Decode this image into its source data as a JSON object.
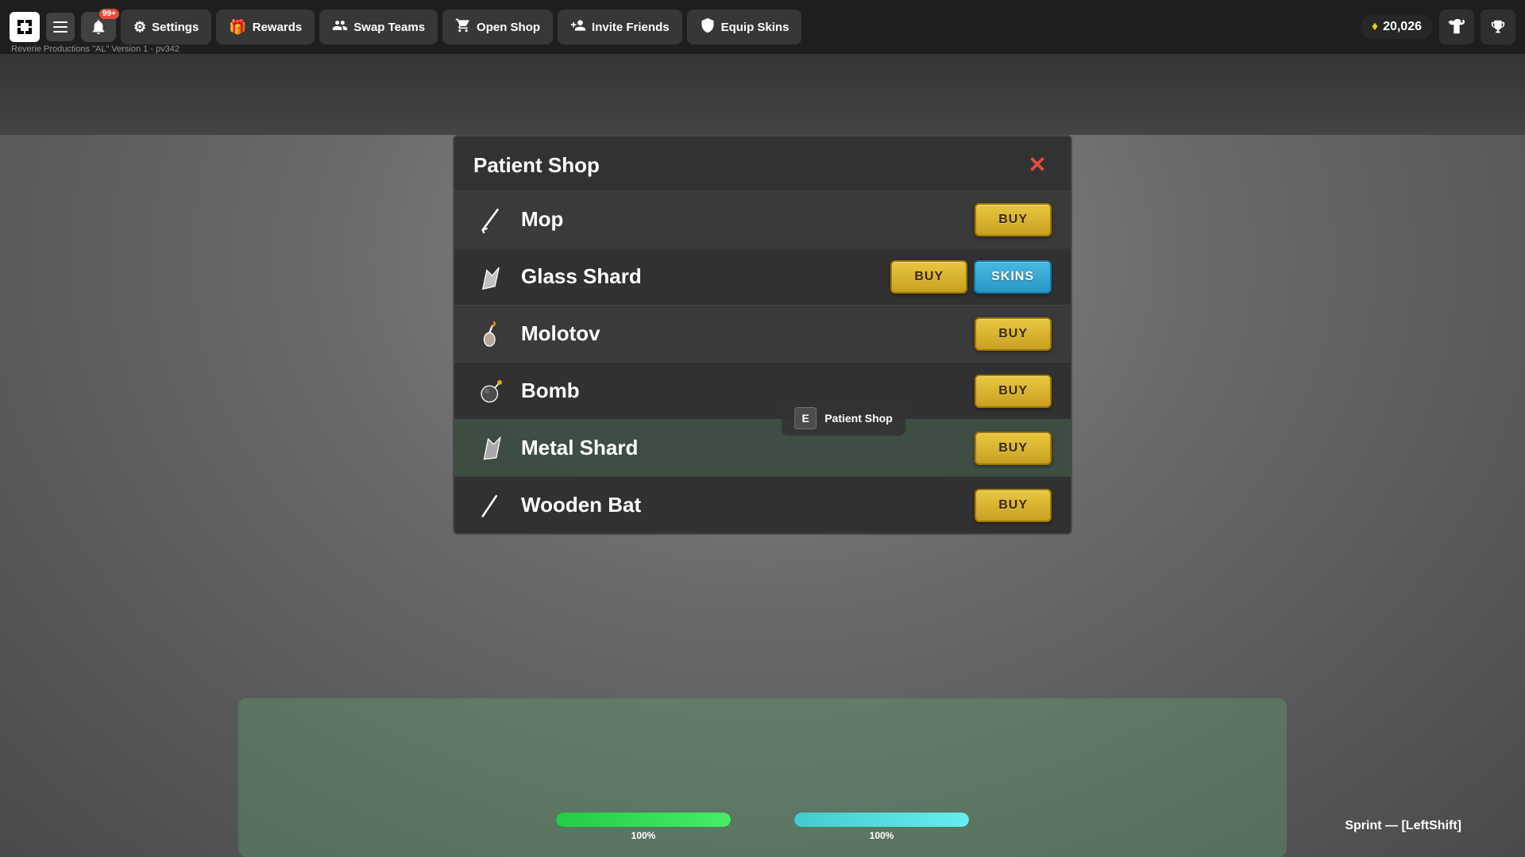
{
  "game": {
    "version": "Reverie Productions \"AL\" Version 1 - pv342"
  },
  "topbar": {
    "notifications_count": "99+",
    "buttons": [
      {
        "id": "settings",
        "label": "Settings",
        "icon": "⚙"
      },
      {
        "id": "rewards",
        "label": "Rewards",
        "icon": "🎁"
      },
      {
        "id": "swap-teams",
        "label": "Swap Teams",
        "icon": "👥"
      },
      {
        "id": "open-shop",
        "label": "Open Shop",
        "icon": "🛒"
      },
      {
        "id": "invite-friends",
        "label": "Invite Friends",
        "icon": "👤"
      },
      {
        "id": "equip-skins",
        "label": "Equip Skins",
        "icon": "🎮"
      }
    ],
    "coins": "20,026",
    "coin_symbol": "♦"
  },
  "shop": {
    "title": "Patient Shop",
    "close_label": "✕",
    "items": [
      {
        "id": "mop",
        "name": "Mop",
        "icon": "mop",
        "has_buy": true,
        "has_skins": false
      },
      {
        "id": "glass-shard",
        "name": "Glass Shard",
        "icon": "glass-shard",
        "has_buy": true,
        "has_skins": true
      },
      {
        "id": "molotov",
        "name": "Molotov",
        "icon": "molotov",
        "has_buy": true,
        "has_skins": false
      },
      {
        "id": "bomb",
        "name": "Bomb",
        "icon": "bomb",
        "has_buy": true,
        "has_skins": false
      },
      {
        "id": "metal-shard",
        "name": "Metal Shard",
        "icon": "metal-shard",
        "has_buy": true,
        "has_skins": false
      },
      {
        "id": "wooden-bat",
        "name": "Wooden Bat",
        "icon": "wooden-bat",
        "has_buy": true,
        "has_skins": false
      }
    ],
    "buy_label": "BUY",
    "skins_label": "SKINS",
    "tooltip_key": "E",
    "tooltip_label": "Patient Shop"
  },
  "hud": {
    "health_pct": "100%",
    "sprint_pct": "100%",
    "sprint_hint": "Sprint — [LeftShift]"
  }
}
